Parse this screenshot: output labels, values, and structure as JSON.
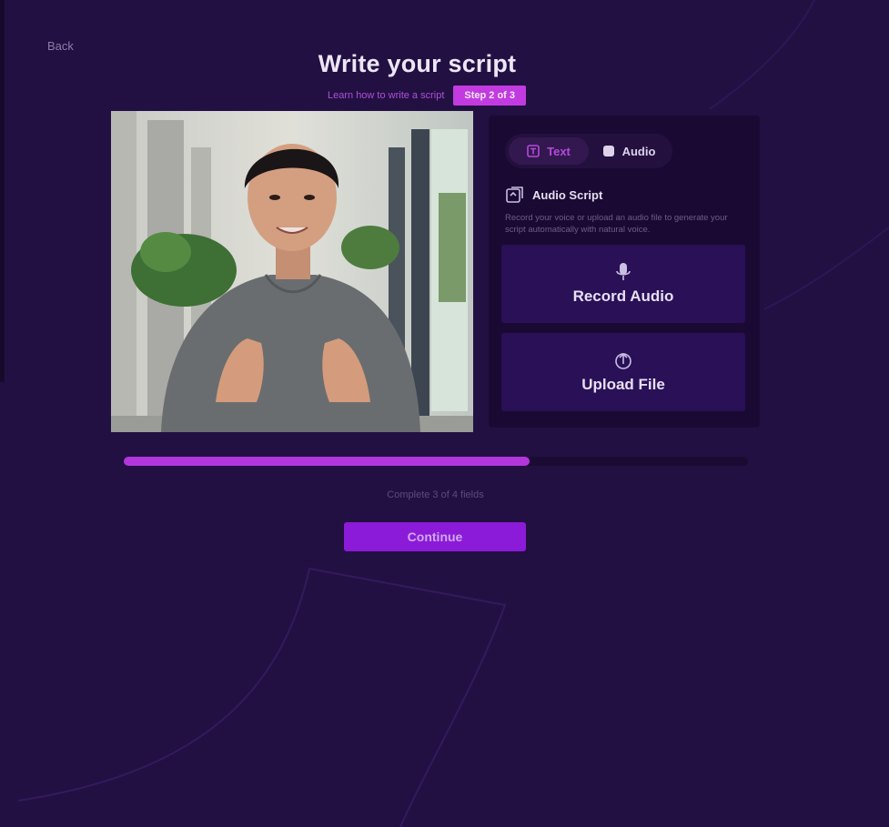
{
  "nav": {
    "back_label": "Back"
  },
  "page": {
    "title": "Write your script",
    "subtitle_link": "Learn how to write a script",
    "badge": "Step 2 of 3"
  },
  "video": {
    "thumbnail": "presenter-portrait"
  },
  "panel": {
    "tabs": [
      {
        "label": "Text",
        "icon": "text-icon",
        "active": true
      },
      {
        "label": "Audio",
        "icon": "audio-icon",
        "active": false
      }
    ],
    "heading": "Audio Script",
    "heading_icon": "audio-script-icon",
    "description": "Record your voice or upload an audio file to generate your script automatically with natural voice.",
    "actions": [
      {
        "label": "Record Audio",
        "icon": "microphone-icon"
      },
      {
        "label": "Upload File",
        "icon": "upload-icon"
      }
    ]
  },
  "progress": {
    "fraction": 0.65,
    "text": "Complete 3 of 4 fields"
  },
  "footer": {
    "continue_label": "Continue"
  },
  "colors": {
    "background": "#221043",
    "accent": "#b236dc",
    "button": "#8b1bd8"
  }
}
